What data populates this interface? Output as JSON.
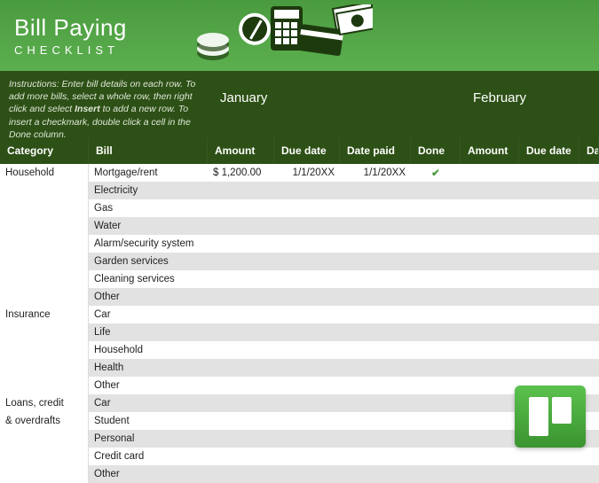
{
  "header": {
    "title": "Bill Paying",
    "subtitle": "CHECKLIST"
  },
  "instructions": {
    "text_a": "Instructions: Enter bill details on each row. To add more bills, select a whole row, then right click and select ",
    "bold": "Insert",
    "text_b": " to add a new row. To insert a checkmark, double click a cell in the Done column."
  },
  "months": {
    "m1": "January",
    "m2": "February"
  },
  "columns": {
    "category": "Category",
    "bill": "Bill",
    "amount": "Amount",
    "due": "Due date",
    "paid": "Date paid",
    "done": "Done",
    "amount2": "Amount",
    "due2": "Due date",
    "paid2": "Date pa"
  },
  "rows": [
    {
      "cat": "Household",
      "bill": "Mortgage/rent",
      "amt": "$    1,200.00",
      "due": "1/1/20XX",
      "paid": "1/1/20XX",
      "done": "✔"
    },
    {
      "cat": "",
      "bill": "Electricity",
      "amt": "",
      "due": "",
      "paid": "",
      "done": ""
    },
    {
      "cat": "",
      "bill": "Gas",
      "amt": "",
      "due": "",
      "paid": "",
      "done": ""
    },
    {
      "cat": "",
      "bill": "Water",
      "amt": "",
      "due": "",
      "paid": "",
      "done": ""
    },
    {
      "cat": "",
      "bill": "Alarm/security system",
      "amt": "",
      "due": "",
      "paid": "",
      "done": ""
    },
    {
      "cat": "",
      "bill": "Garden services",
      "amt": "",
      "due": "",
      "paid": "",
      "done": ""
    },
    {
      "cat": "",
      "bill": "Cleaning services",
      "amt": "",
      "due": "",
      "paid": "",
      "done": ""
    },
    {
      "cat": "",
      "bill": "Other",
      "amt": "",
      "due": "",
      "paid": "",
      "done": ""
    },
    {
      "cat": "Insurance",
      "bill": "Car",
      "amt": "",
      "due": "",
      "paid": "",
      "done": ""
    },
    {
      "cat": "",
      "bill": "Life",
      "amt": "",
      "due": "",
      "paid": "",
      "done": ""
    },
    {
      "cat": "",
      "bill": "Household",
      "amt": "",
      "due": "",
      "paid": "",
      "done": ""
    },
    {
      "cat": "",
      "bill": "Health",
      "amt": "",
      "due": "",
      "paid": "",
      "done": ""
    },
    {
      "cat": "",
      "bill": "Other",
      "amt": "",
      "due": "",
      "paid": "",
      "done": ""
    },
    {
      "cat": "Loans, credit",
      "bill": "Car",
      "amt": "",
      "due": "",
      "paid": "",
      "done": ""
    },
    {
      "cat": "& overdrafts",
      "bill": "Student",
      "amt": "",
      "due": "",
      "paid": "",
      "done": ""
    },
    {
      "cat": "",
      "bill": "Personal",
      "amt": "",
      "due": "",
      "paid": "",
      "done": ""
    },
    {
      "cat": "",
      "bill": "Credit card",
      "amt": "",
      "due": "",
      "paid": "",
      "done": ""
    },
    {
      "cat": "",
      "bill": "Other",
      "amt": "",
      "due": "",
      "paid": "",
      "done": ""
    }
  ]
}
